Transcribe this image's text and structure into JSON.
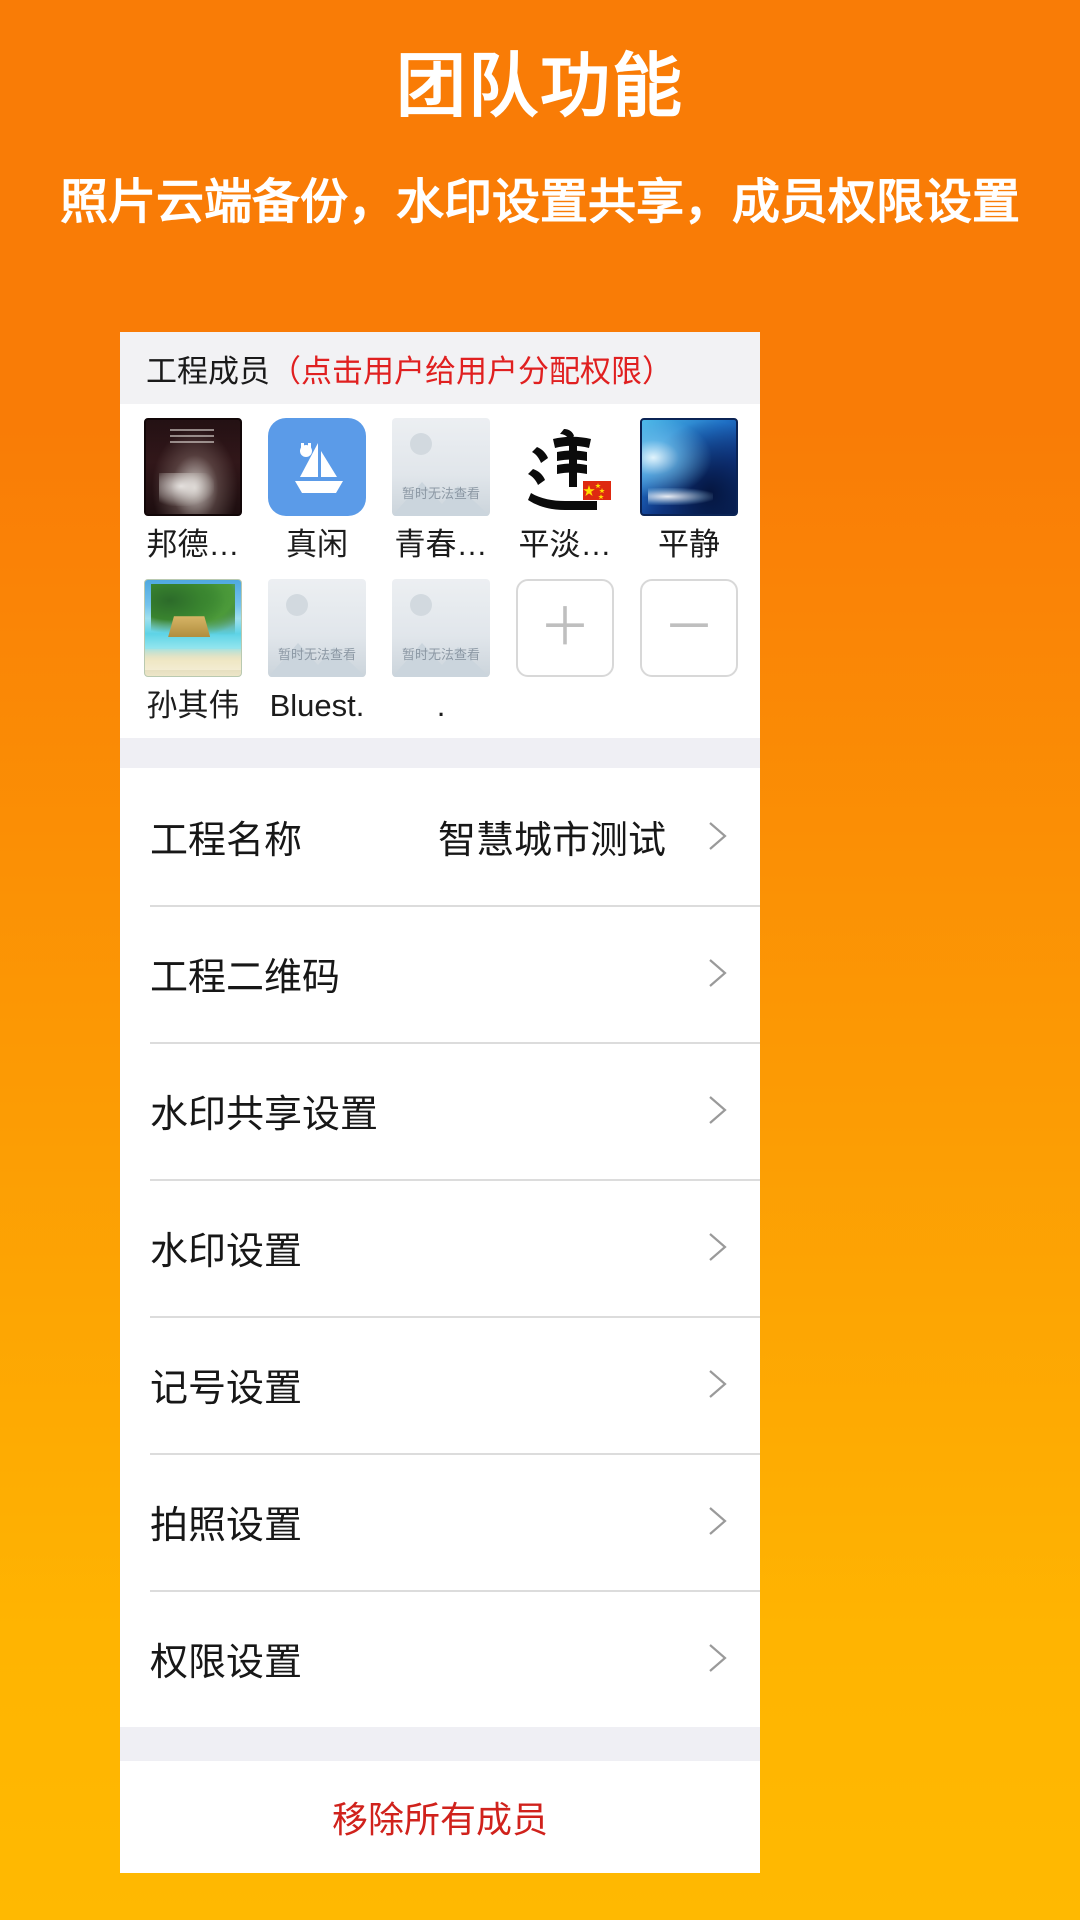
{
  "promo": {
    "title": "团队功能",
    "subtitle": "照片云端备份，水印设置共享，成员权限设置",
    "bg_top_color": "#F97C06",
    "bg_bottom_color": "#FFB901"
  },
  "members_section": {
    "title": "工程成员",
    "hint": "（点击用户给用户分配权限）",
    "hint_color": "#E02020",
    "members": [
      {
        "name": "邦德…",
        "avatar": "movie-poster-photo"
      },
      {
        "name": "真闲",
        "avatar": "sailboat-icon"
      },
      {
        "name": "青春…",
        "avatar": "image-unavailable-placeholder",
        "placeholder_text": "暂时无法查看"
      },
      {
        "name": "平淡…",
        "avatar": "dao-calligraphy-with-flag"
      },
      {
        "name": "平静",
        "avatar": "ocean-wave-photo"
      },
      {
        "name": "孙其伟",
        "avatar": "tropical-beach-photo"
      },
      {
        "name": "Bluest.",
        "avatar": "image-unavailable-placeholder",
        "placeholder_text": "暂时无法查看"
      },
      {
        "name": ".",
        "avatar": "image-unavailable-placeholder",
        "placeholder_text": "暂时无法查看"
      }
    ],
    "add_button_label": "＋",
    "remove_button_label": "－"
  },
  "settings": {
    "rows": [
      {
        "label": "工程名称",
        "value": "智慧城市测试"
      },
      {
        "label": "工程二维码",
        "value": ""
      },
      {
        "label": "水印共享设置",
        "value": ""
      },
      {
        "label": "水印设置",
        "value": ""
      },
      {
        "label": "记号设置",
        "value": ""
      },
      {
        "label": "拍照设置",
        "value": ""
      },
      {
        "label": "权限设置",
        "value": ""
      }
    ]
  },
  "footer": {
    "remove_all_label": "移除所有成员",
    "remove_all_color": "#D0221C"
  }
}
